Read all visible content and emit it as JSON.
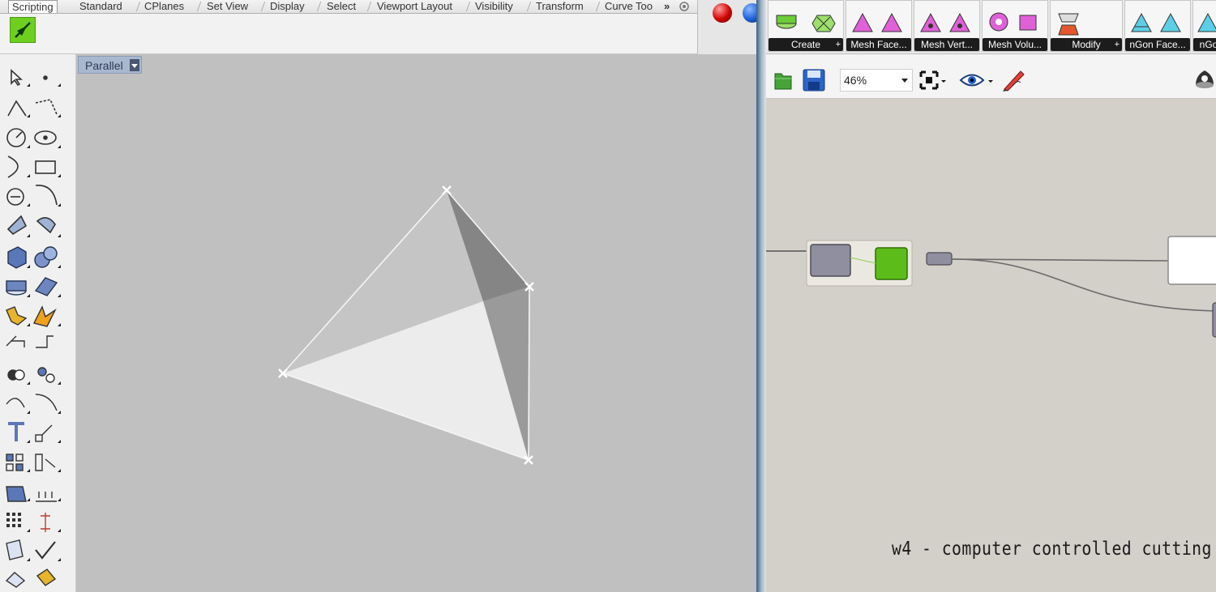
{
  "rhino": {
    "tabs": [
      "Scripting",
      "Standard",
      "CPlanes",
      "Set View",
      "Display",
      "Select",
      "Viewport Layout",
      "Visibility",
      "Transform",
      "Curve Too"
    ],
    "tab_overflow": "»",
    "active_tab": "Scripting",
    "viewport_title": "Parallel"
  },
  "grasshopper": {
    "panels": [
      {
        "label": "Create",
        "plus": "+"
      },
      {
        "label": "Mesh Face..."
      },
      {
        "label": "Mesh Vert..."
      },
      {
        "label": "Mesh Volu..."
      },
      {
        "label": "Modify",
        "plus": "+"
      },
      {
        "label": "nGon Face..."
      },
      {
        "label": "nGo"
      }
    ],
    "zoom": "46%",
    "caption": "w4 - computer controlled cutting"
  },
  "colors": {
    "viewport_bg": "#c0c0c0",
    "canvas_bg": "#d3cfc9",
    "script_green": "#6ecf1f",
    "gh_node_green": "#5cbd1a",
    "gh_node_grey": "#8f8f9f"
  }
}
